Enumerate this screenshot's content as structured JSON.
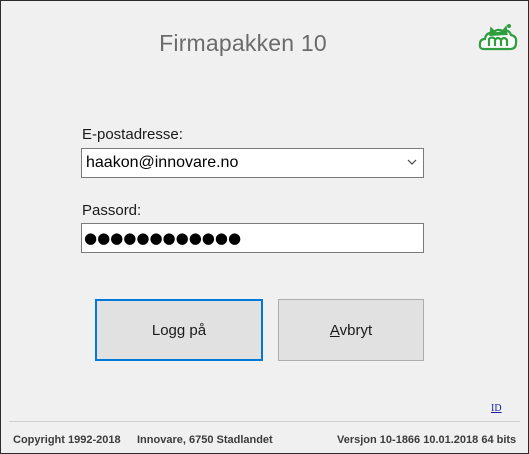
{
  "app_title": "Firmapakken 10",
  "logo_icon": "green-cat-cloud-logo-icon",
  "form": {
    "email_label": "E-postadresse:",
    "email_value": "haakon@innovare.no",
    "password_label": "Passord:",
    "password_mask": "●●●●●●●●●●●●"
  },
  "buttons": {
    "login": "Logg på",
    "cancel_first": "A",
    "cancel_rest": "vbryt"
  },
  "id_link": "ID",
  "footer": {
    "copyright": "Copyright 1992-2018",
    "address": "Innovare, 6750 Stadlandet",
    "version": "Versjon 10-1866  10.01.2018  64 bits"
  },
  "colors": {
    "focus_border": "#0078d7",
    "logo_green": "#2e9e3e",
    "background": "#f0f0f0"
  }
}
